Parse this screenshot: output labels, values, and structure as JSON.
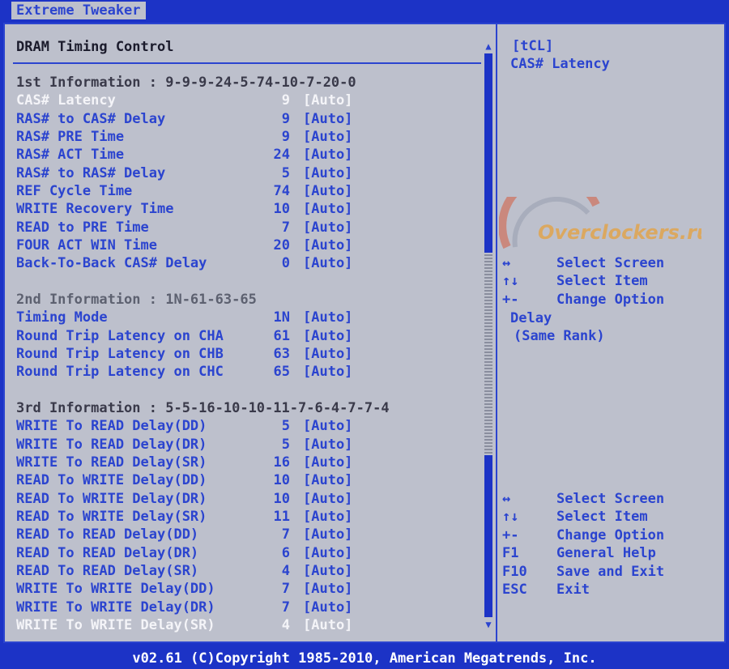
{
  "tab": {
    "label": "Extreme Tweaker"
  },
  "panel": {
    "title": "DRAM Timing Control"
  },
  "rows": [
    {
      "type": "head",
      "label": "1st Information : 9-9-9-24-5-74-10-7-20-0"
    },
    {
      "type": "item",
      "label": "CAS# Latency",
      "value": "9",
      "option": "[Auto]",
      "selected": true
    },
    {
      "type": "item",
      "label": "RAS# to CAS# Delay",
      "value": "9",
      "option": "[Auto]"
    },
    {
      "type": "item",
      "label": "RAS# PRE Time",
      "value": "9",
      "option": "[Auto]"
    },
    {
      "type": "item",
      "label": "RAS# ACT Time",
      "value": "24",
      "option": "[Auto]"
    },
    {
      "type": "item",
      "label": "RAS# to RAS# Delay",
      "value": "5",
      "option": "[Auto]"
    },
    {
      "type": "item",
      "label": "REF Cycle Time",
      "value": "74",
      "option": "[Auto]"
    },
    {
      "type": "item",
      "label": "WRITE Recovery Time",
      "value": "10",
      "option": "[Auto]"
    },
    {
      "type": "item",
      "label": "READ to PRE Time",
      "value": "7",
      "option": "[Auto]"
    },
    {
      "type": "item",
      "label": "FOUR ACT WIN Time",
      "value": "20",
      "option": "[Auto]"
    },
    {
      "type": "item",
      "label": "Back-To-Back CAS# Delay",
      "value": "0",
      "option": "[Auto]"
    },
    {
      "type": "blank"
    },
    {
      "type": "dim",
      "label": "2nd Information : 1N-61-63-65"
    },
    {
      "type": "item",
      "label": "Timing Mode",
      "value": "1N",
      "option": "[Auto]"
    },
    {
      "type": "item",
      "label": "Round Trip Latency on CHA",
      "value": "61",
      "option": "[Auto]"
    },
    {
      "type": "item",
      "label": "Round Trip Latency on CHB",
      "value": "63",
      "option": "[Auto]"
    },
    {
      "type": "item",
      "label": "Round Trip Latency on CHC",
      "value": "65",
      "option": "[Auto]"
    },
    {
      "type": "blank"
    },
    {
      "type": "head",
      "label": "3rd Information : 5-5-16-10-10-11-7-6-4-7-7-4"
    },
    {
      "type": "item",
      "label": "WRITE To READ Delay(DD)",
      "value": "5",
      "option": "[Auto]"
    },
    {
      "type": "item",
      "label": "WRITE To READ Delay(DR)",
      "value": "5",
      "option": "[Auto]"
    },
    {
      "type": "item",
      "label": "WRITE To READ Delay(SR)",
      "value": "16",
      "option": "[Auto]"
    },
    {
      "type": "item",
      "label": "READ To WRITE Delay(DD)",
      "value": "10",
      "option": "[Auto]"
    },
    {
      "type": "item",
      "label": "READ To WRITE Delay(DR)",
      "value": "10",
      "option": "[Auto]"
    },
    {
      "type": "item",
      "label": "READ To WRITE Delay(SR)",
      "value": "11",
      "option": "[Auto]"
    },
    {
      "type": "item",
      "label": "READ To READ Delay(DD)",
      "value": "7",
      "option": "[Auto]"
    },
    {
      "type": "item",
      "label": "READ To READ Delay(DR)",
      "value": "6",
      "option": "[Auto]"
    },
    {
      "type": "item",
      "label": "READ To READ Delay(SR)",
      "value": "4",
      "option": "[Auto]"
    },
    {
      "type": "item",
      "label": "WRITE To WRITE Delay(DD)",
      "value": "7",
      "option": "[Auto]"
    },
    {
      "type": "item",
      "label": "WRITE To WRITE Delay(DR)",
      "value": "7",
      "option": "[Auto]"
    },
    {
      "type": "item",
      "label": "WRITE To WRITE Delay(SR)",
      "value": "4",
      "option": "[Auto]",
      "selected": true
    }
  ],
  "help": {
    "line1": "[tCL]",
    "line2": "CAS# Latency",
    "ghost1": "Delay",
    "ghost2": "(Same Rank)"
  },
  "keys_top": [
    {
      "key": "↔",
      "desc": "Select Screen"
    },
    {
      "key": "↑↓",
      "desc": "Select Item"
    },
    {
      "key": "+-",
      "desc": "Change Option"
    }
  ],
  "keys_bottom": [
    {
      "key": "↔",
      "desc": "Select Screen"
    },
    {
      "key": "↑↓",
      "desc": "Select Item"
    },
    {
      "key": "+-",
      "desc": "Change Option"
    },
    {
      "key": "F1",
      "desc": "General Help"
    },
    {
      "key": "F10",
      "desc": "Save and Exit"
    },
    {
      "key": "ESC",
      "desc": "Exit"
    }
  ],
  "watermark": {
    "text": "Overclockers.ru"
  },
  "footer": {
    "text": "v02.61 (C)Copyright 1985-2010, American Megatrends, Inc."
  }
}
